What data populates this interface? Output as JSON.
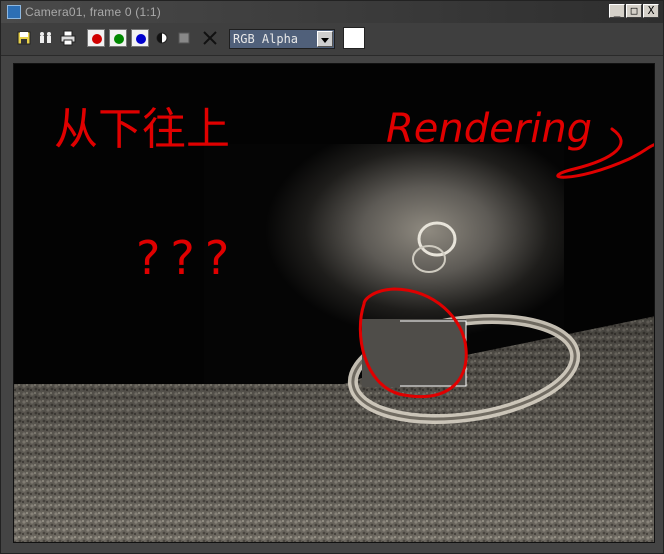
{
  "window": {
    "title": "Camera01, frame 0 (1:1)",
    "buttons": {
      "minimize": "_",
      "maximize": "□",
      "close": "X"
    }
  },
  "toolbar": {
    "icons": [
      "save-icon",
      "clone-icon",
      "print-icon",
      "red-channel-icon",
      "green-channel-icon",
      "blue-channel-icon",
      "monochrome-icon",
      "alpha-icon",
      "clear-icon"
    ],
    "channel_colors": {
      "red": "#d00000",
      "green": "#008800",
      "blue": "#0000cc"
    },
    "channel_select": {
      "value": "RGB Alpha"
    },
    "color_swatch": "#ffffff"
  },
  "render": {
    "annotation_chinese": "从下往上",
    "annotation_english": "Rendering",
    "annotation_questions": "???",
    "annotation_color": "#e00000"
  }
}
